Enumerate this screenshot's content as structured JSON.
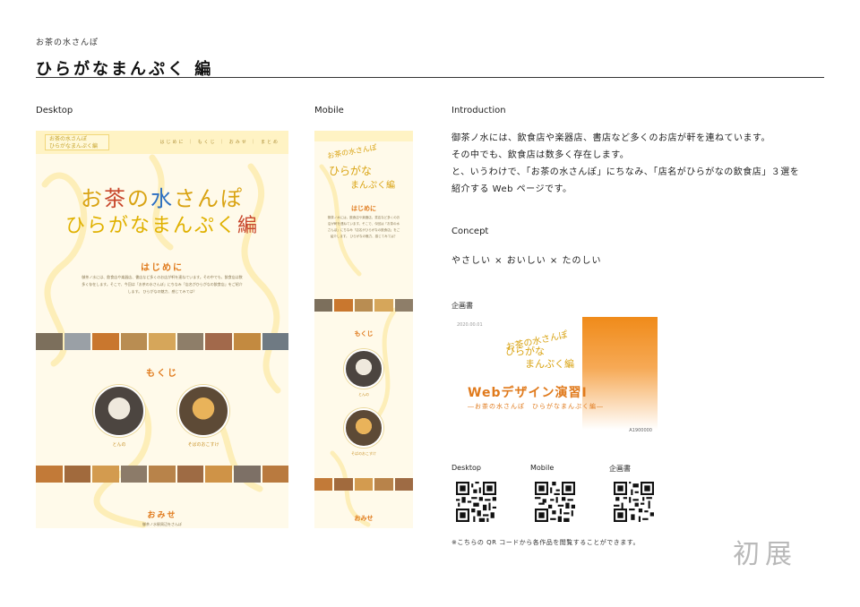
{
  "header": {
    "subtitle": "お茶の水さんぽ",
    "title": "ひらがなまんぷく 編"
  },
  "columns": {
    "desktop": "Desktop",
    "mobile": "Mobile",
    "introduction": "Introduction",
    "concept": "Concept",
    "plan": "企画書"
  },
  "desktop_mock": {
    "logo_line1": "お茶の水さんぽ",
    "logo_line2": "ひらがなまんぷく編",
    "menu": "はじめに ｜ もくじ ｜ おみせ ｜ まとめ",
    "hero_1a": "お",
    "hero_1b": "茶",
    "hero_1c": "の",
    "hero_1d": "水",
    "hero_1e": "さんぽ",
    "hero_2a": "ひらがなまんぷく",
    "hero_2b": "編",
    "intro_heading": "はじめに",
    "intro_body": "御茶ノ水には、飲食店や楽器店、書店など多くのお店が軒を連ねています。その中でも、飲食店は数多く存在します。そこで、今回は「お茶の水さんぽ」にちなみ「店名がひらがなの飲食店」をご紹介します。 ひらがなの魅力、感じてみては？",
    "toc_heading": "もくじ",
    "toc_cap1": "とんの",
    "toc_cap2": "そばのおこすけ",
    "shops_heading": "おみせ",
    "footer_text": "御茶ノ水駅周辺をさんぽ"
  },
  "mobile_mock": {
    "logo_line1": "お茶の水さんぽ",
    "logo_line2": "ひらがな",
    "logo_line3": "まんぷく編",
    "intro_heading": "はじめに",
    "intro_body": "御茶ノ水には、飲食店や楽器店、書店など多くのお店が軒を連ねています。そこで、今回は「お茶の水さんぽ」にちなみ「店名がひらがなの飲食店」をご紹介します。 ひらがなの魅力、感じてみては？",
    "toc_heading": "もくじ",
    "toc_cap1": "とんの",
    "toc_cap2": "そばのおこすけ",
    "shops_heading": "おみせ"
  },
  "introduction": {
    "line1": "御茶ノ水には、飲食店や楽器店、書店など多くのお店が軒を連ねています。",
    "line2": "その中でも、飲食店は数多く存在します。",
    "line3": "と、いうわけで、「お茶の水さんぽ」にちなみ、「店名がひらがなの飲食店」３選を",
    "line4": "紹介する Web ページです。"
  },
  "concept": {
    "text": "やさしい × おいしい × たのしい"
  },
  "plan_doc": {
    "date": "2020.00.01",
    "logo1": "お茶の水さんぽ",
    "logo2": "ひらがな",
    "logo3": "まんぷく編",
    "title": "Webデザイン演習Ⅰ",
    "subtitle": "―お茶の水さんぽ　ひらがなまんぷく編―",
    "id": "A1900000"
  },
  "qr": {
    "desktop_label": "Desktop",
    "mobile_label": "Mobile",
    "plan_label": "企画書"
  },
  "note": "※こちらの QR コードから各作品を閲覧することができます。",
  "watermark": "初展",
  "colors": {
    "accent_orange": "#e07a1c",
    "logo_yellow": "#d9a312",
    "logo_blue": "#2b6fc2",
    "page_cream": "#fffaea"
  }
}
